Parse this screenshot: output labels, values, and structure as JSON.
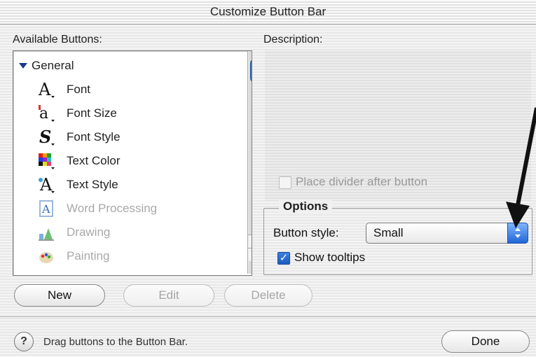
{
  "window": {
    "title": "Customize Button Bar"
  },
  "available": {
    "label": "Available Buttons:",
    "items": [
      {
        "label": "General",
        "type": "category",
        "icon": "disclosure-triangle-down-icon"
      },
      {
        "label": "Font",
        "icon": "font-icon",
        "glyph": "A"
      },
      {
        "label": "Font Size",
        "icon": "font-size-icon",
        "glyph": "a"
      },
      {
        "label": "Font Style",
        "icon": "font-style-icon",
        "glyph": "S"
      },
      {
        "label": "Text Color",
        "icon": "text-color-icon"
      },
      {
        "label": "Text Style",
        "icon": "text-style-icon",
        "glyph": "A"
      },
      {
        "label": "Word Processing",
        "icon": "word-processing-icon",
        "glyph": "A",
        "disabled": true
      },
      {
        "label": "Drawing",
        "icon": "drawing-icon",
        "disabled": true
      },
      {
        "label": "Painting",
        "icon": "painting-icon",
        "disabled": true
      }
    ]
  },
  "description": {
    "label": "Description:",
    "divider_checkbox": {
      "label": "Place divider after button",
      "checked": false,
      "disabled": true
    }
  },
  "options": {
    "title": "Options",
    "button_style_label": "Button style:",
    "button_style_value": "Small",
    "tooltips": {
      "label": "Show tooltips",
      "checked": true
    }
  },
  "buttons": {
    "new": "New",
    "edit": "Edit",
    "delete": "Delete",
    "done": "Done"
  },
  "status": {
    "help_glyph": "?",
    "text": "Drag buttons to the Button Bar."
  },
  "colors": {
    "accent": "#2166d6",
    "annotation_arrow": "#111111"
  }
}
